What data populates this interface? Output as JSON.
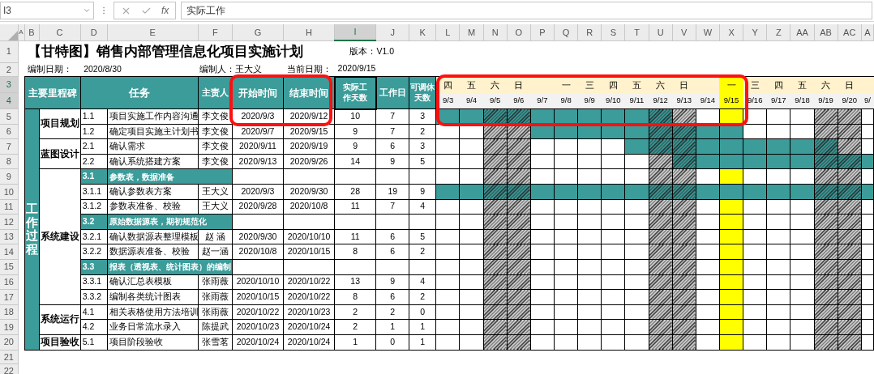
{
  "formula_bar": {
    "cell_ref": "I3",
    "function_label": "fx",
    "content": "实际工作"
  },
  "column_headers": [
    {
      "label": "A",
      "selected": false
    },
    {
      "label": "B",
      "selected": false
    },
    {
      "label": "C",
      "selected": false
    },
    {
      "label": "D",
      "selected": false
    },
    {
      "label": "E",
      "selected": false
    },
    {
      "label": "F",
      "selected": false
    },
    {
      "label": "G",
      "selected": false
    },
    {
      "label": "H",
      "selected": false
    },
    {
      "label": "I",
      "selected": true
    },
    {
      "label": "J",
      "selected": false
    },
    {
      "label": "K",
      "selected": false
    },
    {
      "label": "L",
      "selected": false
    },
    {
      "label": "M",
      "selected": false
    },
    {
      "label": "N",
      "selected": false
    },
    {
      "label": "O",
      "selected": false
    },
    {
      "label": "P",
      "selected": false
    },
    {
      "label": "Q",
      "selected": false
    },
    {
      "label": "R",
      "selected": false
    },
    {
      "label": "S",
      "selected": false
    },
    {
      "label": "T",
      "selected": false
    },
    {
      "label": "U",
      "selected": false
    },
    {
      "label": "V",
      "selected": false
    },
    {
      "label": "W",
      "selected": false
    },
    {
      "label": "X",
      "selected": false
    },
    {
      "label": "Y",
      "selected": false
    },
    {
      "label": "Z",
      "selected": false
    },
    {
      "label": "AA",
      "selected": false
    },
    {
      "label": "AB",
      "selected": false
    },
    {
      "label": "AC",
      "selected": false
    },
    {
      "label": "A",
      "selected": false
    }
  ],
  "row_numbers": [
    {
      "label": "1",
      "selected": false
    },
    {
      "label": "2",
      "selected": false
    },
    {
      "label": "3",
      "selected": true
    },
    {
      "label": "4",
      "selected": true
    },
    {
      "label": "5",
      "selected": false
    },
    {
      "label": "6",
      "selected": false
    },
    {
      "label": "7",
      "selected": false
    },
    {
      "label": "8",
      "selected": false
    },
    {
      "label": "9",
      "selected": false
    },
    {
      "label": "10",
      "selected": false
    },
    {
      "label": "11",
      "selected": false
    },
    {
      "label": "12",
      "selected": false
    },
    {
      "label": "13",
      "selected": false
    },
    {
      "label": "14",
      "selected": false
    },
    {
      "label": "15",
      "selected": false
    },
    {
      "label": "16",
      "selected": false
    },
    {
      "label": "17",
      "selected": false
    },
    {
      "label": "18",
      "selected": false
    },
    {
      "label": "19",
      "selected": false
    },
    {
      "label": "20",
      "selected": false
    },
    {
      "label": "21",
      "selected": false
    },
    {
      "label": "22",
      "selected": false
    }
  ],
  "title": "【甘特图】销售内部管理信息化项目实施计划",
  "version": "版本：V1.0",
  "meta": [
    {
      "label": "编制日期：",
      "value": "2020/8/30"
    },
    {
      "label": "编制人：",
      "value": "王大义"
    },
    {
      "label": "当前日期：",
      "value": "2020/9/15"
    }
  ],
  "headers": {
    "milestone": "主要里程碑",
    "task": "任务",
    "owner": "主责人",
    "start": "开始时间",
    "end": "结束时间",
    "actual_days": "实际工作天数",
    "workdays": "工作日",
    "rest_days": "可调休天数"
  },
  "days": [
    {
      "weekday": "四",
      "date": "9/3",
      "weekend": false,
      "today": false
    },
    {
      "weekday": "五",
      "date": "9/4",
      "weekend": false,
      "today": false
    },
    {
      "weekday": "六",
      "date": "9/5",
      "weekend": true,
      "today": false
    },
    {
      "weekday": "日",
      "date": "9/6",
      "weekend": true,
      "today": false
    },
    {
      "date": "9/7",
      "weekend": false,
      "today": false
    },
    {
      "weekday": "一",
      "date": "9/8",
      "weekend": false,
      "today": false
    },
    {
      "weekday": "三",
      "date": "9/9",
      "weekend": false,
      "today": false
    },
    {
      "weekday": "四",
      "date": "9/10",
      "weekend": false,
      "today": false
    },
    {
      "weekday": "五",
      "date": "9/11",
      "weekend": false,
      "today": false
    },
    {
      "weekday": "六",
      "date": "9/12",
      "weekend": true,
      "today": false
    },
    {
      "weekday": "日",
      "date": "9/13",
      "weekend": true,
      "today": false
    },
    {
      "date": "9/14",
      "weekend": false,
      "today": false
    },
    {
      "weekday": "一",
      "date": "9/15",
      "weekend": false,
      "today": true
    },
    {
      "weekday": "三",
      "date": "9/16",
      "weekend": false,
      "today": false
    },
    {
      "weekday": "四",
      "date": "9/17",
      "weekend": false,
      "today": false
    },
    {
      "weekday": "五",
      "date": "9/18",
      "weekend": false,
      "today": false
    },
    {
      "weekday": "六",
      "date": "9/19",
      "weekend": true,
      "today": false
    },
    {
      "weekday": "日",
      "date": "9/20",
      "weekend": true,
      "today": false
    },
    {
      "date": "9/",
      "weekend": false,
      "today": false
    }
  ],
  "phase": "工作过程",
  "milestones": [
    {
      "name": "项目规划",
      "tasks": [
        {
          "kind": "task",
          "no": "1.1",
          "name": "项目实施工作内容沟通",
          "owner": "李文俊",
          "start": "2020/9/3",
          "end": "2020/9/12",
          "actual_days": "10",
          "workdays": "7",
          "rest_days": "3",
          "bar": [
            true,
            true,
            true,
            true,
            true,
            true,
            true,
            true,
            true,
            true,
            false,
            false,
            false,
            false,
            false,
            false,
            false,
            false,
            false
          ]
        },
        {
          "kind": "task",
          "no": "1.2",
          "name": "确定项目实施主计划书",
          "owner": "李文俊",
          "start": "2020/9/7",
          "end": "2020/9/15",
          "actual_days": "9",
          "workdays": "7",
          "rest_days": "2",
          "bar": [
            false,
            false,
            false,
            false,
            true,
            true,
            true,
            true,
            true,
            true,
            true,
            true,
            true,
            false,
            false,
            false,
            false,
            false,
            false
          ]
        }
      ]
    },
    {
      "name": "蓝图设计",
      "tasks": [
        {
          "kind": "task",
          "no": "2.1",
          "name": "确认需求",
          "owner": "李文俊",
          "start": "2020/9/11",
          "end": "2020/9/19",
          "actual_days": "9",
          "workdays": "6",
          "rest_days": "3",
          "bar": [
            false,
            false,
            false,
            false,
            false,
            false,
            false,
            false,
            true,
            true,
            true,
            true,
            true,
            true,
            true,
            true,
            true,
            false,
            false
          ]
        },
        {
          "kind": "task",
          "no": "2.2",
          "name": "确认系统搭建方案",
          "owner": "李文俊",
          "start": "2020/9/13",
          "end": "2020/9/26",
          "actual_days": "14",
          "workdays": "9",
          "rest_days": "5",
          "bar": [
            false,
            false,
            false,
            false,
            false,
            false,
            false,
            false,
            false,
            false,
            true,
            true,
            true,
            true,
            true,
            true,
            true,
            true,
            true
          ]
        }
      ]
    },
    {
      "name": "系统建设",
      "tasks": [
        {
          "kind": "section",
          "no": "3.1",
          "name": "参数表，数据准备"
        },
        {
          "kind": "task",
          "no": "3.1.1",
          "name": "确认参数表方案",
          "owner": "王大义",
          "start": "2020/9/3",
          "end": "2020/9/30",
          "actual_days": "28",
          "workdays": "19",
          "rest_days": "9",
          "bar": [
            true,
            true,
            true,
            true,
            true,
            true,
            true,
            true,
            true,
            true,
            true,
            true,
            true,
            true,
            true,
            true,
            true,
            true,
            true
          ]
        },
        {
          "kind": "task",
          "no": "3.1.2",
          "name": "参数表准备、校验",
          "owner": "王大义",
          "start": "2020/9/28",
          "end": "2020/10/8",
          "actual_days": "11",
          "workdays": "7",
          "rest_days": "4"
        },
        {
          "kind": "section",
          "no": "3.2",
          "name": "原始数据源表，期初规范化"
        },
        {
          "kind": "task",
          "no": "3.2.1",
          "name": "确认数据源表整理模板",
          "owner": "赵 涵",
          "start": "2020/9/30",
          "end": "2020/10/10",
          "actual_days": "11",
          "workdays": "6",
          "rest_days": "5"
        },
        {
          "kind": "task",
          "no": "3.2.2",
          "name": "数据源表准备、校验",
          "owner": "赵一涵",
          "start": "2020/10/8",
          "end": "2020/10/15",
          "actual_days": "8",
          "workdays": "6",
          "rest_days": "2"
        },
        {
          "kind": "section",
          "no": "3.3",
          "name": "报表（透视表、统计图表）的编制"
        },
        {
          "kind": "task",
          "no": "3.3.1",
          "name": "确认汇总表模板",
          "owner": "张雨薇",
          "start": "2020/10/10",
          "end": "2020/10/22",
          "actual_days": "13",
          "workdays": "9",
          "rest_days": "4"
        },
        {
          "kind": "task",
          "no": "3.3.2",
          "name": "编制各类统计图表",
          "owner": "张雨薇",
          "start": "2020/10/15",
          "end": "2020/10/22",
          "actual_days": "8",
          "workdays": "6",
          "rest_days": "2"
        }
      ]
    },
    {
      "name": "系统运行",
      "tasks": [
        {
          "kind": "task",
          "no": "4.1",
          "name": "相关表格使用方法培训",
          "owner": "张雨薇",
          "start": "2020/10/22",
          "end": "2020/10/23",
          "actual_days": "2",
          "workdays": "2",
          "rest_days": "0"
        },
        {
          "kind": "task",
          "no": "4.2",
          "name": "业务日常流水录入",
          "owner": "陈提武",
          "start": "2020/10/23",
          "end": "2020/10/24",
          "actual_days": "2",
          "workdays": "1",
          "rest_days": "1"
        }
      ]
    },
    {
      "name": "项目验收",
      "tasks": [
        {
          "kind": "task",
          "no": "5.1",
          "name": "项目阶段验收",
          "owner": "张雪茗",
          "start": "2020/10/24",
          "end": "2020/10/24",
          "actual_days": "1",
          "workdays": "0",
          "rest_days": "1"
        }
      ]
    }
  ]
}
